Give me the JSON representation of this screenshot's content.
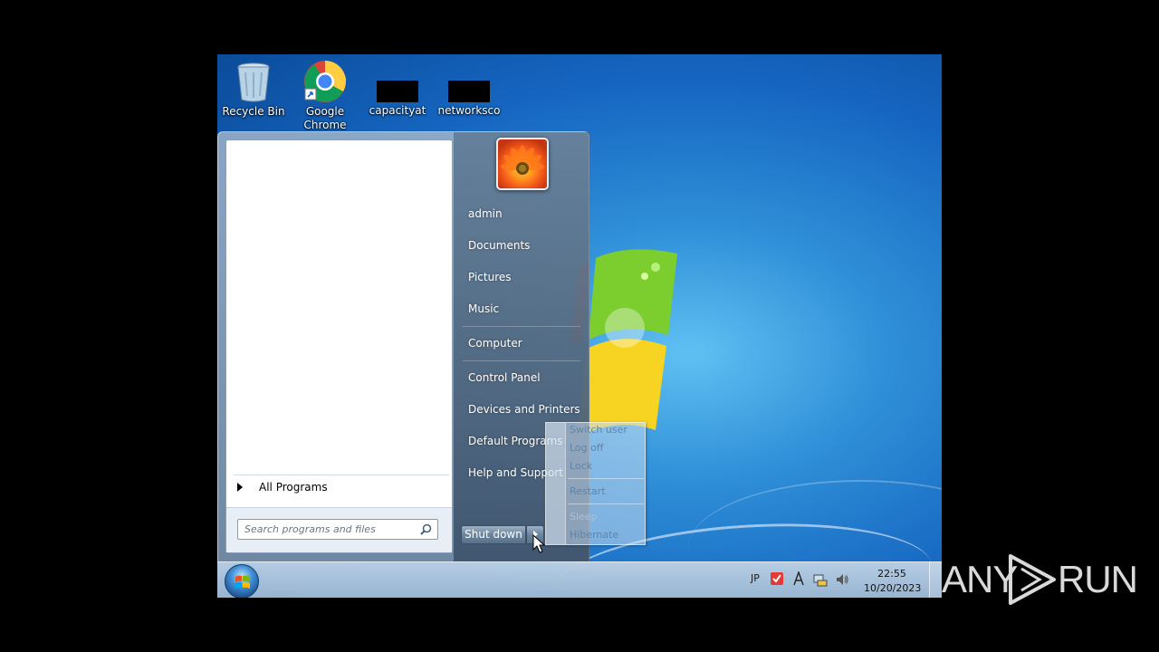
{
  "desktop": {
    "icons": [
      {
        "label": "Recycle Bin",
        "icon": "recycle-bin-icon"
      },
      {
        "label": "Google\nChrome",
        "icon": "chrome-icon"
      },
      {
        "label": "capacityat",
        "icon": "redacted-file-icon"
      },
      {
        "label": "networksco",
        "icon": "redacted-file-icon"
      }
    ]
  },
  "start_menu": {
    "all_programs": "All Programs",
    "search_placeholder": "Search programs and files",
    "user": "admin",
    "right_items": [
      "admin",
      "Documents",
      "Pictures",
      "Music",
      "Computer",
      "Control Panel",
      "Devices and Printers",
      "Default Programs",
      "Help and Support"
    ],
    "shutdown_label": "Shut down"
  },
  "shutdown_flyout": {
    "items": [
      "Switch user",
      "Log off",
      "Lock",
      "Restart",
      "Sleep",
      "Hibernate"
    ]
  },
  "taskbar": {
    "language": "JP",
    "time": "22:55",
    "date": "10/20/2023"
  },
  "watermark": {
    "text_left": "ANY",
    "text_right": "RUN"
  }
}
